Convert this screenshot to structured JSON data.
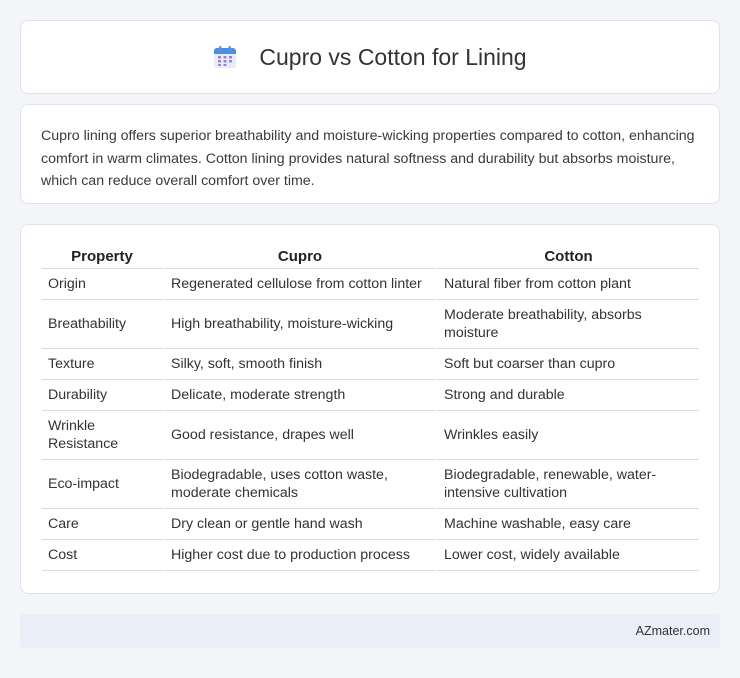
{
  "header": {
    "title": "Cupro vs Cotton for Lining",
    "icon": "calendar-icon",
    "icon_colors": {
      "top": "#4a90e2",
      "body": "#e8ecf7",
      "dots": "#9b7fd6"
    }
  },
  "intro": {
    "text": "Cupro lining offers superior breathability and moisture-wicking properties compared to cotton, enhancing comfort in warm climates. Cotton lining provides natural softness and durability but absorbs moisture, which can reduce overall comfort over time."
  },
  "table": {
    "headers": [
      "Property",
      "Cupro",
      "Cotton"
    ],
    "rows": [
      [
        "Origin",
        "Regenerated cellulose from cotton linter",
        "Natural fiber from cotton plant"
      ],
      [
        "Breathability",
        "High breathability, moisture-wicking",
        "Moderate breathability, absorbs moisture"
      ],
      [
        "Texture",
        "Silky, soft, smooth finish",
        "Soft but coarser than cupro"
      ],
      [
        "Durability",
        "Delicate, moderate strength",
        "Strong and durable"
      ],
      [
        "Wrinkle Resistance",
        "Good resistance, drapes well",
        "Wrinkles easily"
      ],
      [
        "Eco-impact",
        "Biodegradable, uses cotton waste, moderate chemicals",
        "Biodegradable, renewable, water-intensive cultivation"
      ],
      [
        "Care",
        "Dry clean or gentle hand wash",
        "Machine washable, easy care"
      ],
      [
        "Cost",
        "Higher cost due to production process",
        "Lower cost, widely available"
      ]
    ]
  },
  "footer": {
    "text": "AZmater.com"
  }
}
